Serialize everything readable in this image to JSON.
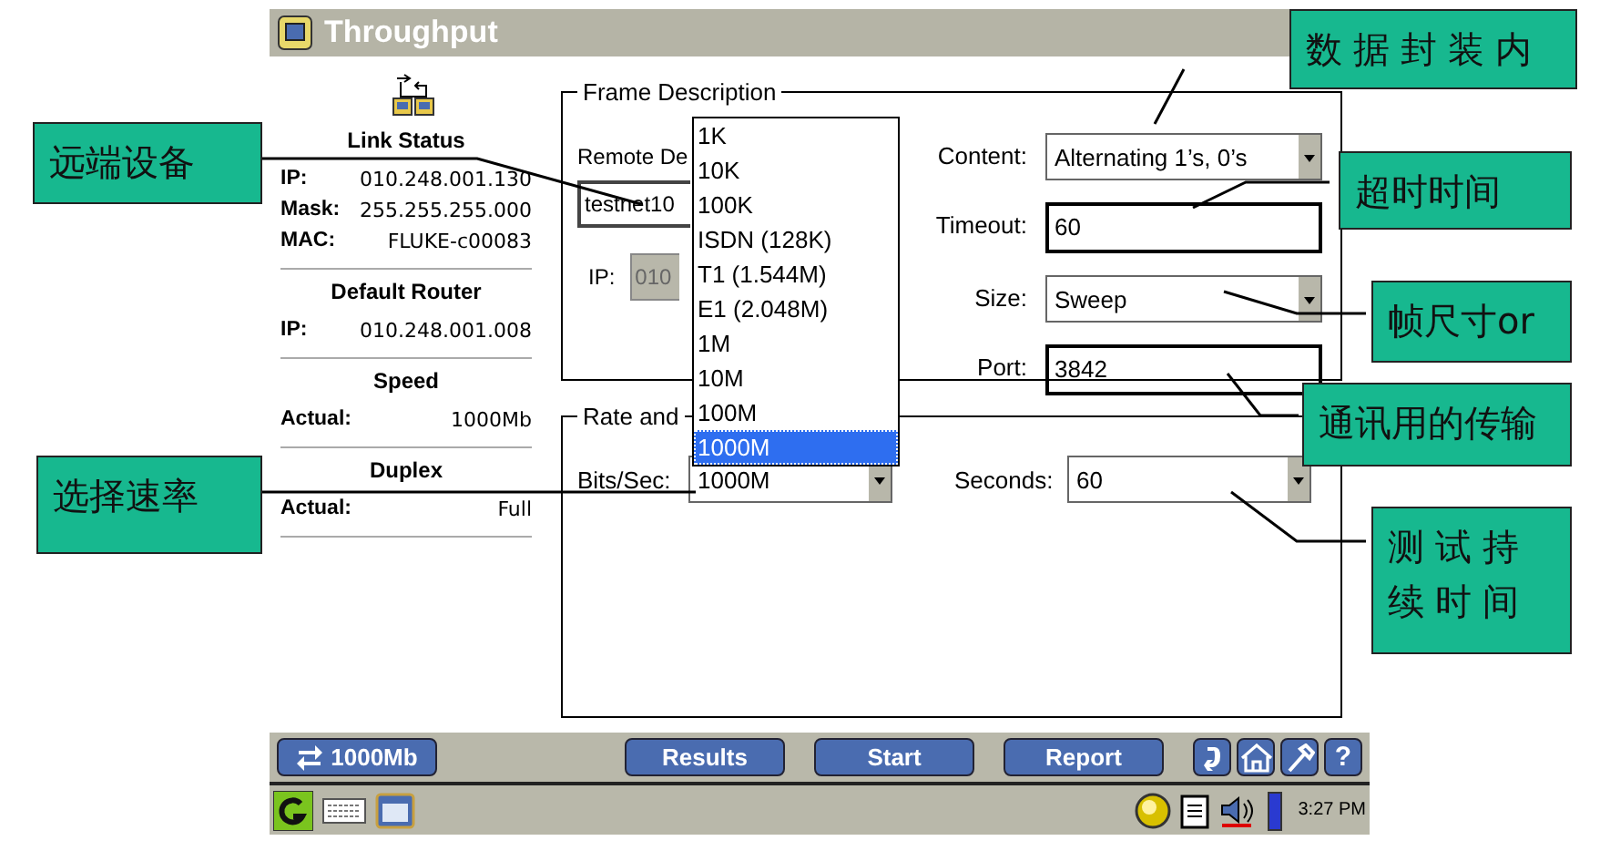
{
  "window": {
    "title": "Throughput"
  },
  "status_sections": [
    {
      "heading": "Link Status",
      "rows": [
        {
          "label": "IP:",
          "value": "010.248.001.130"
        },
        {
          "label": "Mask:",
          "value": "255.255.255.000"
        },
        {
          "label": "MAC:",
          "value": "FLUKE-c00083"
        }
      ]
    },
    {
      "heading": "Default Router",
      "rows": [
        {
          "label": "IP:",
          "value": "010.248.001.008"
        }
      ]
    },
    {
      "heading": "Speed",
      "rows": [
        {
          "label": "Actual:",
          "value": "1000Mb"
        }
      ]
    },
    {
      "heading": "Duplex",
      "rows": [
        {
          "label": "Actual:",
          "value": "Full"
        }
      ]
    }
  ],
  "frame_description": {
    "title": "Frame Description",
    "remote_label": "Remote De",
    "remote_value": "testnet10",
    "ip_label": "IP:",
    "ip_value": "010",
    "ip_disabled": true,
    "fields": [
      {
        "kind": "dropdown",
        "label": "Content:",
        "value": "Alternating 1’s, 0’s"
      },
      {
        "kind": "input",
        "label": "Timeout:",
        "value": "60"
      },
      {
        "kind": "dropdown",
        "label": "Size:",
        "value": "Sweep"
      },
      {
        "kind": "input",
        "label": "Port:",
        "value": "3842"
      }
    ]
  },
  "rate": {
    "title": "Rate and",
    "bits_label": "Bits/Sec:",
    "bits_value": "1000M",
    "seconds_label": "Seconds:",
    "seconds_value": "60"
  },
  "rate_options": [
    {
      "label": "1K",
      "selected": false
    },
    {
      "label": "10K",
      "selected": false
    },
    {
      "label": "100K",
      "selected": false
    },
    {
      "label": "ISDN (128K)",
      "selected": false
    },
    {
      "label": "T1 (1.544M)",
      "selected": false
    },
    {
      "label": "E1 (2.048M)",
      "selected": false
    },
    {
      "label": "1M",
      "selected": false
    },
    {
      "label": "10M",
      "selected": false
    },
    {
      "label": "100M",
      "selected": false
    },
    {
      "label": "1000M",
      "selected": true
    }
  ],
  "toolbar": {
    "speed": "1000Mb",
    "buttons": [
      "Results",
      "Start",
      "Report"
    ],
    "help": "?"
  },
  "taskbar": {
    "time": "3:27 PM"
  },
  "callouts": [
    {
      "text": "数据封装内"
    },
    {
      "text": "超时时间"
    },
    {
      "text": "帧尺寸or"
    },
    {
      "text": "通讯用的传输"
    },
    {
      "text": "测试持续时间"
    },
    {
      "text": "远端设备"
    },
    {
      "text": "选择速率"
    }
  ]
}
